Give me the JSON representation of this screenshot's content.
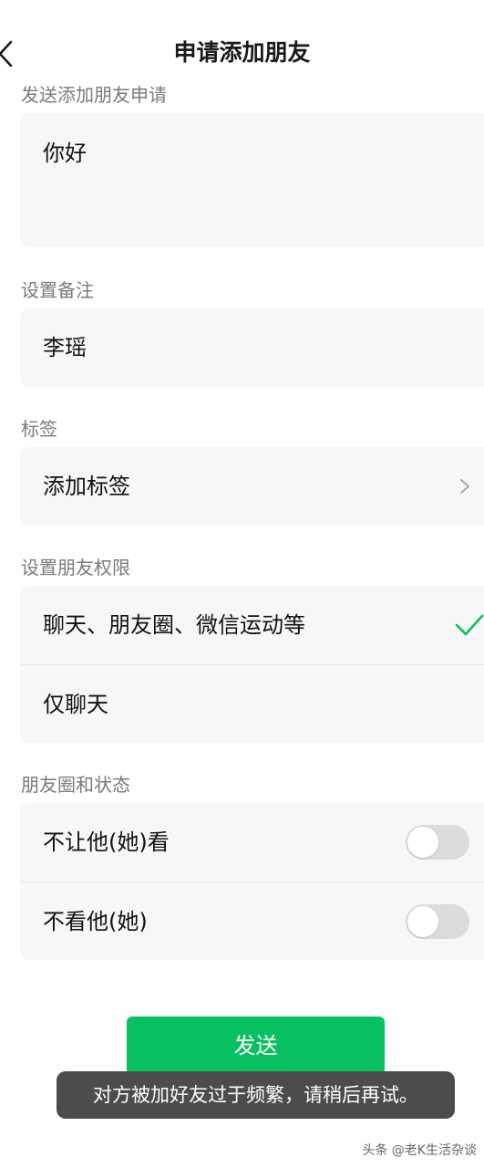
{
  "status_bar": {
    "left_text": "",
    "right_text": ""
  },
  "nav": {
    "title": "申请添加朋友"
  },
  "request_section": {
    "label": "发送添加朋友申请",
    "message": "你好"
  },
  "remark_section": {
    "label": "设置备注",
    "value": "李瑶"
  },
  "tag_section": {
    "label": "标签",
    "add_label": "添加标签"
  },
  "permission_section": {
    "label": "设置朋友权限",
    "options": [
      {
        "label": "聊天、朋友圈、微信运动等",
        "selected": true
      },
      {
        "label": "仅聊天",
        "selected": false
      }
    ]
  },
  "moments_section": {
    "label": "朋友圈和状态",
    "toggles": [
      {
        "label": "不让他(她)看",
        "on": false
      },
      {
        "label": "不看他(她)",
        "on": false
      }
    ]
  },
  "send_button": {
    "label": "发送"
  },
  "toast": {
    "text": "对方被加好友过于频繁，请稍后再试。"
  },
  "watermark": {
    "text": "头条 @老K生活杂谈"
  },
  "colors": {
    "accent": "#07c160",
    "card_bg": "#f7f7f7",
    "toast_bg": "#4c4c4c"
  },
  "icons": {
    "back": "chevron-left-icon",
    "chevron": "chevron-right-icon",
    "check": "check-icon"
  }
}
